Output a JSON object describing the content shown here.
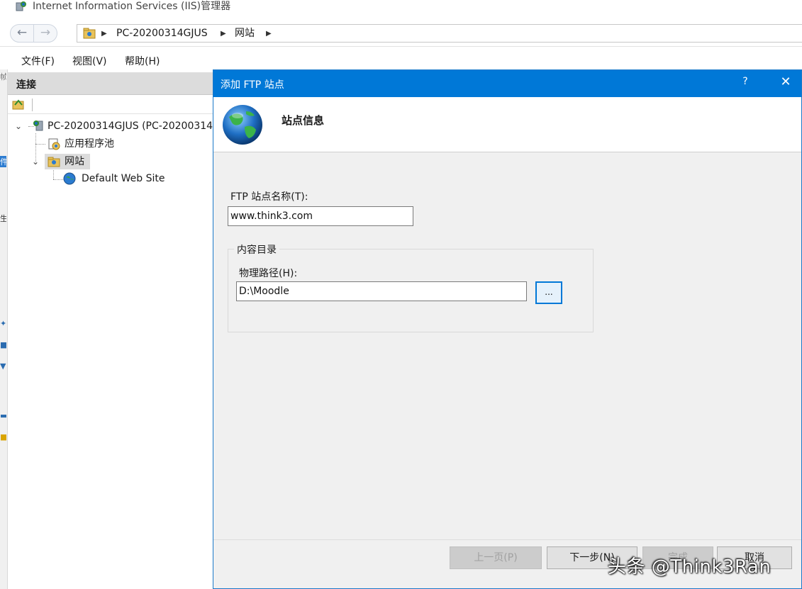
{
  "window": {
    "title": "Internet Information Services (IIS)管理器"
  },
  "address": {
    "crumbs": [
      "PC-20200314GJUS",
      "网站"
    ]
  },
  "menu": [
    "文件(F)",
    "视图(V)",
    "帮助(H)"
  ],
  "connections": {
    "header": "连接",
    "tree": {
      "server": "PC-20200314GJUS (PC-20200314",
      "app_pools": "应用程序池",
      "sites": "网站",
      "default_site": "Default Web Site"
    }
  },
  "left_edge_marks": [
    "帧",
    "件",
    "生"
  ],
  "dialog": {
    "title": "添加 FTP 站点",
    "help_glyph": "?",
    "close_glyph": "✕",
    "heading": "站点信息",
    "site_name_label": "FTP 站点名称(T):",
    "site_name_value": "www.think3.com",
    "content_group_label": "内容目录",
    "physical_path_label": "物理路径(H):",
    "physical_path_value": "D:\\Moodle",
    "browse_label": "...",
    "buttons": {
      "prev": "上一页(P)",
      "next": "下一步(N)",
      "finish": "完成",
      "cancel": "取消"
    }
  },
  "watermark": "头条 @Think3Ran",
  "colors": {
    "accent": "#0078d7",
    "dialog_bg": "#f0f0f0",
    "header_bg": "#dcdcdc"
  }
}
